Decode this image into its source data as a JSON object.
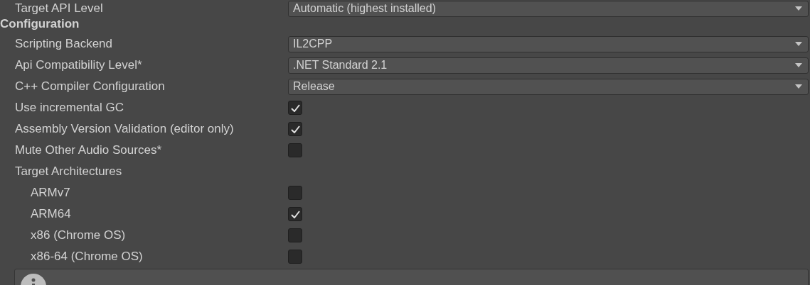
{
  "top_field": {
    "label": "Target API Level",
    "value": "Automatic (highest installed)"
  },
  "section": {
    "title": "Configuration",
    "rows": [
      {
        "kind": "dropdown",
        "label": "Scripting Backend",
        "value": "IL2CPP"
      },
      {
        "kind": "dropdown",
        "label": "Api Compatibility Level*",
        "value": ".NET Standard 2.1"
      },
      {
        "kind": "dropdown",
        "label": "C++ Compiler Configuration",
        "value": "Release"
      },
      {
        "kind": "checkbox",
        "label": "Use incremental GC",
        "checked": true
      },
      {
        "kind": "checkbox",
        "label": "Assembly Version Validation (editor only)",
        "checked": true
      },
      {
        "kind": "checkbox",
        "label": "Mute Other Audio Sources*",
        "checked": false
      },
      {
        "kind": "group",
        "label": "Target Architectures",
        "children": [
          {
            "kind": "checkbox",
            "label": "ARMv7",
            "checked": false
          },
          {
            "kind": "checkbox",
            "label": "ARM64",
            "checked": true
          },
          {
            "kind": "checkbox",
            "label": "x86 (Chrome OS)",
            "checked": false
          },
          {
            "kind": "checkbox",
            "label": "x86-64 (Chrome OS)",
            "checked": false
          }
        ]
      }
    ]
  },
  "help_box": {
    "kind": "info"
  }
}
